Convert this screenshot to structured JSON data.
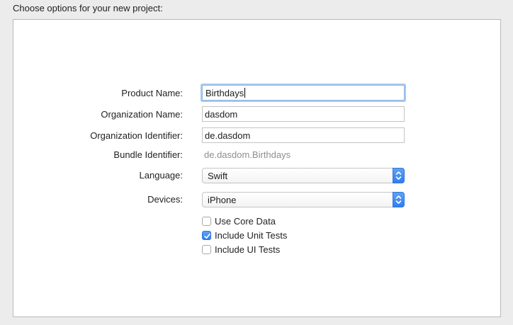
{
  "header": {
    "title": "Choose options for your new project:"
  },
  "form": {
    "product_name": {
      "label": "Product Name:",
      "value": "Birthdays"
    },
    "organization_name": {
      "label": "Organization Name:",
      "value": "dasdom"
    },
    "organization_identifier": {
      "label": "Organization Identifier:",
      "value": "de.dasdom"
    },
    "bundle_identifier": {
      "label": "Bundle Identifier:",
      "value": "de.dasdom.Birthdays"
    },
    "language": {
      "label": "Language:",
      "selected": "Swift"
    },
    "devices": {
      "label": "Devices:",
      "selected": "iPhone"
    },
    "options": [
      {
        "label": "Use Core Data",
        "checked": false
      },
      {
        "label": "Include Unit Tests",
        "checked": true
      },
      {
        "label": "Include UI Tests",
        "checked": false
      }
    ]
  },
  "colors": {
    "accent": "#2f7ff0",
    "focus_ring": "#a9c8ef",
    "window_bg": "#ececec",
    "panel_bg": "#ffffff",
    "muted_text": "#8e8e8e"
  }
}
